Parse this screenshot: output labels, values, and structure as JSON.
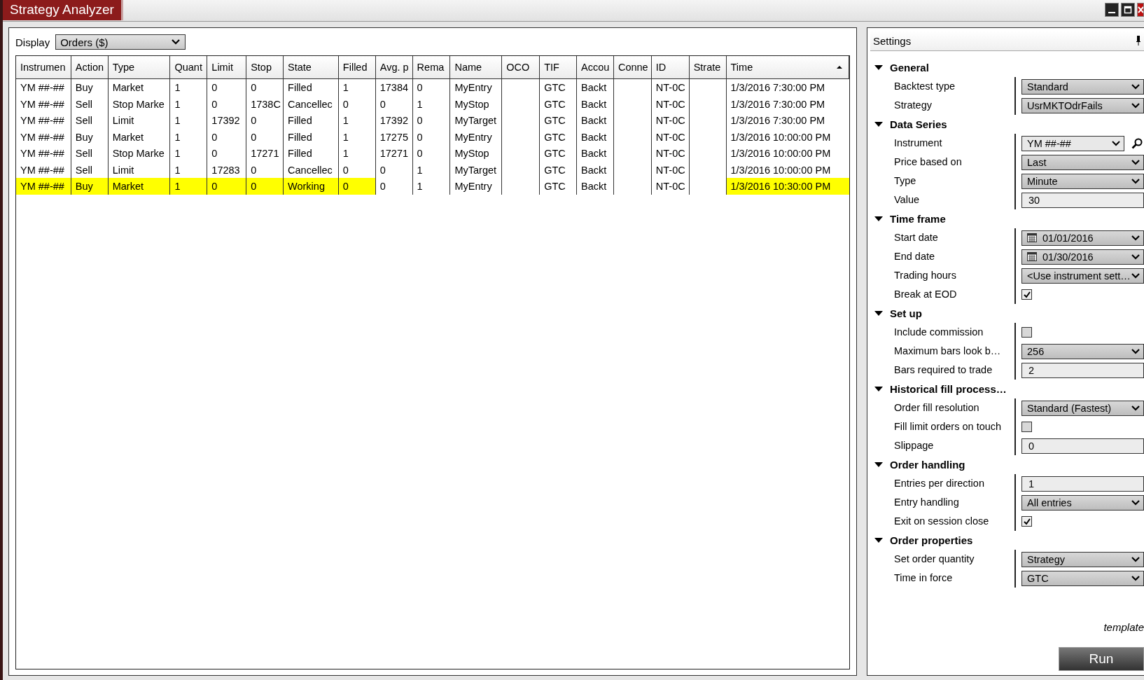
{
  "window": {
    "title": "Strategy Analyzer"
  },
  "display": {
    "label": "Display",
    "value": "Orders ($)"
  },
  "table": {
    "columns": [
      {
        "label": "Instrumen"
      },
      {
        "label": "Action"
      },
      {
        "label": "Type"
      },
      {
        "label": "Quant"
      },
      {
        "label": "Limit"
      },
      {
        "label": "Stop"
      },
      {
        "label": "State"
      },
      {
        "label": "Filled"
      },
      {
        "label": "Avg. p"
      },
      {
        "label": "Rema"
      },
      {
        "label": "Name"
      },
      {
        "label": "OCO"
      },
      {
        "label": "TIF"
      },
      {
        "label": "Accou"
      },
      {
        "label": "Conne"
      },
      {
        "label": "ID"
      },
      {
        "label": "Strate"
      },
      {
        "label": "Time",
        "sorted": true
      }
    ],
    "rows": [
      {
        "cells": [
          {
            "text": "YM ##-##",
            "highlighted": false
          },
          {
            "text": "Buy",
            "highlighted": false
          },
          {
            "text": "Market",
            "highlighted": false
          },
          {
            "text": "1",
            "highlighted": false
          },
          {
            "text": "0",
            "highlighted": false
          },
          {
            "text": "0",
            "highlighted": false
          },
          {
            "text": "Filled",
            "highlighted": false
          },
          {
            "text": "1",
            "highlighted": false
          },
          {
            "text": "17384",
            "highlighted": false
          },
          {
            "text": "0",
            "highlighted": false
          },
          {
            "text": "MyEntry",
            "highlighted": false
          },
          {
            "text": "",
            "highlighted": false
          },
          {
            "text": "GTC",
            "highlighted": false
          },
          {
            "text": "Backt",
            "highlighted": false
          },
          {
            "text": "",
            "highlighted": false
          },
          {
            "text": "NT-0C",
            "highlighted": false
          },
          {
            "text": "",
            "highlighted": false
          },
          {
            "text": "1/3/2016 7:30:00 PM",
            "highlighted": false
          }
        ]
      },
      {
        "cells": [
          {
            "text": "YM ##-##",
            "highlighted": false
          },
          {
            "text": "Sell",
            "highlighted": false
          },
          {
            "text": "Stop Marke",
            "highlighted": false
          },
          {
            "text": "1",
            "highlighted": false
          },
          {
            "text": "0",
            "highlighted": false
          },
          {
            "text": "1738C",
            "highlighted": false
          },
          {
            "text": "Cancellec",
            "highlighted": false
          },
          {
            "text": "0",
            "highlighted": false
          },
          {
            "text": "0",
            "highlighted": false
          },
          {
            "text": "1",
            "highlighted": false
          },
          {
            "text": "MyStop",
            "highlighted": false
          },
          {
            "text": "",
            "highlighted": false
          },
          {
            "text": "GTC",
            "highlighted": false
          },
          {
            "text": "Backt",
            "highlighted": false
          },
          {
            "text": "",
            "highlighted": false
          },
          {
            "text": "NT-0C",
            "highlighted": false
          },
          {
            "text": "",
            "highlighted": false
          },
          {
            "text": "1/3/2016 7:30:00 PM",
            "highlighted": false
          }
        ]
      },
      {
        "cells": [
          {
            "text": "YM ##-##",
            "highlighted": false
          },
          {
            "text": "Sell",
            "highlighted": false
          },
          {
            "text": "Limit",
            "highlighted": false
          },
          {
            "text": "1",
            "highlighted": false
          },
          {
            "text": "17392",
            "highlighted": false
          },
          {
            "text": "0",
            "highlighted": false
          },
          {
            "text": "Filled",
            "highlighted": false
          },
          {
            "text": "1",
            "highlighted": false
          },
          {
            "text": "17392",
            "highlighted": false
          },
          {
            "text": "0",
            "highlighted": false
          },
          {
            "text": "MyTarget",
            "highlighted": false
          },
          {
            "text": "",
            "highlighted": false
          },
          {
            "text": "GTC",
            "highlighted": false
          },
          {
            "text": "Backt",
            "highlighted": false
          },
          {
            "text": "",
            "highlighted": false
          },
          {
            "text": "NT-0C",
            "highlighted": false
          },
          {
            "text": "",
            "highlighted": false
          },
          {
            "text": "1/3/2016 7:30:00 PM",
            "highlighted": false
          }
        ]
      },
      {
        "cells": [
          {
            "text": "YM ##-##",
            "highlighted": false
          },
          {
            "text": "Buy",
            "highlighted": false
          },
          {
            "text": "Market",
            "highlighted": false
          },
          {
            "text": "1",
            "highlighted": false
          },
          {
            "text": "0",
            "highlighted": false
          },
          {
            "text": "0",
            "highlighted": false
          },
          {
            "text": "Filled",
            "highlighted": false
          },
          {
            "text": "1",
            "highlighted": false
          },
          {
            "text": "17275",
            "highlighted": false
          },
          {
            "text": "0",
            "highlighted": false
          },
          {
            "text": "MyEntry",
            "highlighted": false
          },
          {
            "text": "",
            "highlighted": false
          },
          {
            "text": "GTC",
            "highlighted": false
          },
          {
            "text": "Backt",
            "highlighted": false
          },
          {
            "text": "",
            "highlighted": false
          },
          {
            "text": "NT-0C",
            "highlighted": false
          },
          {
            "text": "",
            "highlighted": false
          },
          {
            "text": "1/3/2016 10:00:00 PM",
            "highlighted": false
          }
        ]
      },
      {
        "cells": [
          {
            "text": "YM ##-##",
            "highlighted": false
          },
          {
            "text": "Sell",
            "highlighted": false
          },
          {
            "text": "Stop Marke",
            "highlighted": false
          },
          {
            "text": "1",
            "highlighted": false
          },
          {
            "text": "0",
            "highlighted": false
          },
          {
            "text": "17271",
            "highlighted": false
          },
          {
            "text": "Filled",
            "highlighted": false
          },
          {
            "text": "1",
            "highlighted": false
          },
          {
            "text": "17271",
            "highlighted": false
          },
          {
            "text": "0",
            "highlighted": false
          },
          {
            "text": "MyStop",
            "highlighted": false
          },
          {
            "text": "",
            "highlighted": false
          },
          {
            "text": "GTC",
            "highlighted": false
          },
          {
            "text": "Backt",
            "highlighted": false
          },
          {
            "text": "",
            "highlighted": false
          },
          {
            "text": "NT-0C",
            "highlighted": false
          },
          {
            "text": "",
            "highlighted": false
          },
          {
            "text": "1/3/2016 10:00:00 PM",
            "highlighted": false
          }
        ]
      },
      {
        "cells": [
          {
            "text": "YM ##-##",
            "highlighted": false
          },
          {
            "text": "Sell",
            "highlighted": false
          },
          {
            "text": "Limit",
            "highlighted": false
          },
          {
            "text": "1",
            "highlighted": false
          },
          {
            "text": "17283",
            "highlighted": false
          },
          {
            "text": "0",
            "highlighted": false
          },
          {
            "text": "Cancellec",
            "highlighted": false
          },
          {
            "text": "0",
            "highlighted": false
          },
          {
            "text": "0",
            "highlighted": false
          },
          {
            "text": "1",
            "highlighted": false
          },
          {
            "text": "MyTarget",
            "highlighted": false
          },
          {
            "text": "",
            "highlighted": false
          },
          {
            "text": "GTC",
            "highlighted": false
          },
          {
            "text": "Backt",
            "highlighted": false
          },
          {
            "text": "",
            "highlighted": false
          },
          {
            "text": "NT-0C",
            "highlighted": false
          },
          {
            "text": "",
            "highlighted": false
          },
          {
            "text": "1/3/2016 10:00:00 PM",
            "highlighted": false
          }
        ]
      },
      {
        "cells": [
          {
            "text": "YM ##-##",
            "highlighted": true
          },
          {
            "text": "Buy",
            "highlighted": true
          },
          {
            "text": "Market",
            "highlighted": true
          },
          {
            "text": "1",
            "highlighted": true
          },
          {
            "text": "0",
            "highlighted": true
          },
          {
            "text": "0",
            "highlighted": true
          },
          {
            "text": "Working",
            "highlighted": true
          },
          {
            "text": "0",
            "highlighted": true
          },
          {
            "text": "0",
            "highlighted": false
          },
          {
            "text": "1",
            "highlighted": false
          },
          {
            "text": "MyEntry",
            "highlighted": false
          },
          {
            "text": "",
            "highlighted": false
          },
          {
            "text": "GTC",
            "highlighted": false
          },
          {
            "text": "Backt",
            "highlighted": false
          },
          {
            "text": "",
            "highlighted": false
          },
          {
            "text": "NT-0C",
            "highlighted": false
          },
          {
            "text": "",
            "highlighted": false
          },
          {
            "text": "1/3/2016 10:30:00 PM",
            "highlighted": true
          }
        ]
      }
    ]
  },
  "settings": {
    "title": "Settings",
    "groups": [
      {
        "name": "General",
        "expanded": true,
        "items": [
          {
            "label": "Backtest type",
            "kind": "dropdown",
            "value": "Standard"
          },
          {
            "label": "Strategy",
            "kind": "dropdown",
            "value": "UsrMKTOdrFails"
          }
        ]
      },
      {
        "name": "Data Series",
        "expanded": true,
        "items": [
          {
            "label": "Instrument",
            "kind": "instrument",
            "value": "YM ##-##"
          },
          {
            "label": "Price based on",
            "kind": "dropdown",
            "value": "Last"
          },
          {
            "label": "Type",
            "kind": "dropdown",
            "value": "Minute"
          },
          {
            "label": "Value",
            "kind": "text",
            "value": "30"
          }
        ]
      },
      {
        "name": "Time frame",
        "expanded": true,
        "items": [
          {
            "label": "Start date",
            "kind": "date",
            "value": "01/01/2016"
          },
          {
            "label": "End date",
            "kind": "date",
            "value": "01/30/2016"
          },
          {
            "label": "Trading hours",
            "kind": "dropdown",
            "value": "<Use instrument sett…"
          },
          {
            "label": "Break at EOD",
            "kind": "checkbox",
            "checked": true
          }
        ]
      },
      {
        "name": "Set up",
        "expanded": true,
        "items": [
          {
            "label": "Include commission",
            "kind": "checkbox",
            "checked": false
          },
          {
            "label": "Maximum bars look b…",
            "kind": "dropdown",
            "value": "256"
          },
          {
            "label": "Bars required to trade",
            "kind": "text",
            "value": "2"
          }
        ]
      },
      {
        "name": "Historical fill process…",
        "expanded": true,
        "items": [
          {
            "label": "Order fill resolution",
            "kind": "dropdown",
            "value": "Standard (Fastest)"
          },
          {
            "label": "Fill limit orders on touch",
            "kind": "checkbox",
            "checked": false
          },
          {
            "label": "Slippage",
            "kind": "text",
            "value": "0"
          }
        ]
      },
      {
        "name": "Order handling",
        "expanded": true,
        "items": [
          {
            "label": "Entries per direction",
            "kind": "text",
            "value": "1"
          },
          {
            "label": "Entry handling",
            "kind": "dropdown",
            "value": "All entries"
          },
          {
            "label": "Exit on session close",
            "kind": "checkbox",
            "checked": true
          }
        ]
      },
      {
        "name": "Order properties",
        "expanded": true,
        "items": [
          {
            "label": "Set order quantity",
            "kind": "dropdown",
            "value": "Strategy"
          },
          {
            "label": "Time in force",
            "kind": "dropdown",
            "value": "GTC"
          }
        ]
      }
    ],
    "template": "template",
    "run": "Run"
  }
}
